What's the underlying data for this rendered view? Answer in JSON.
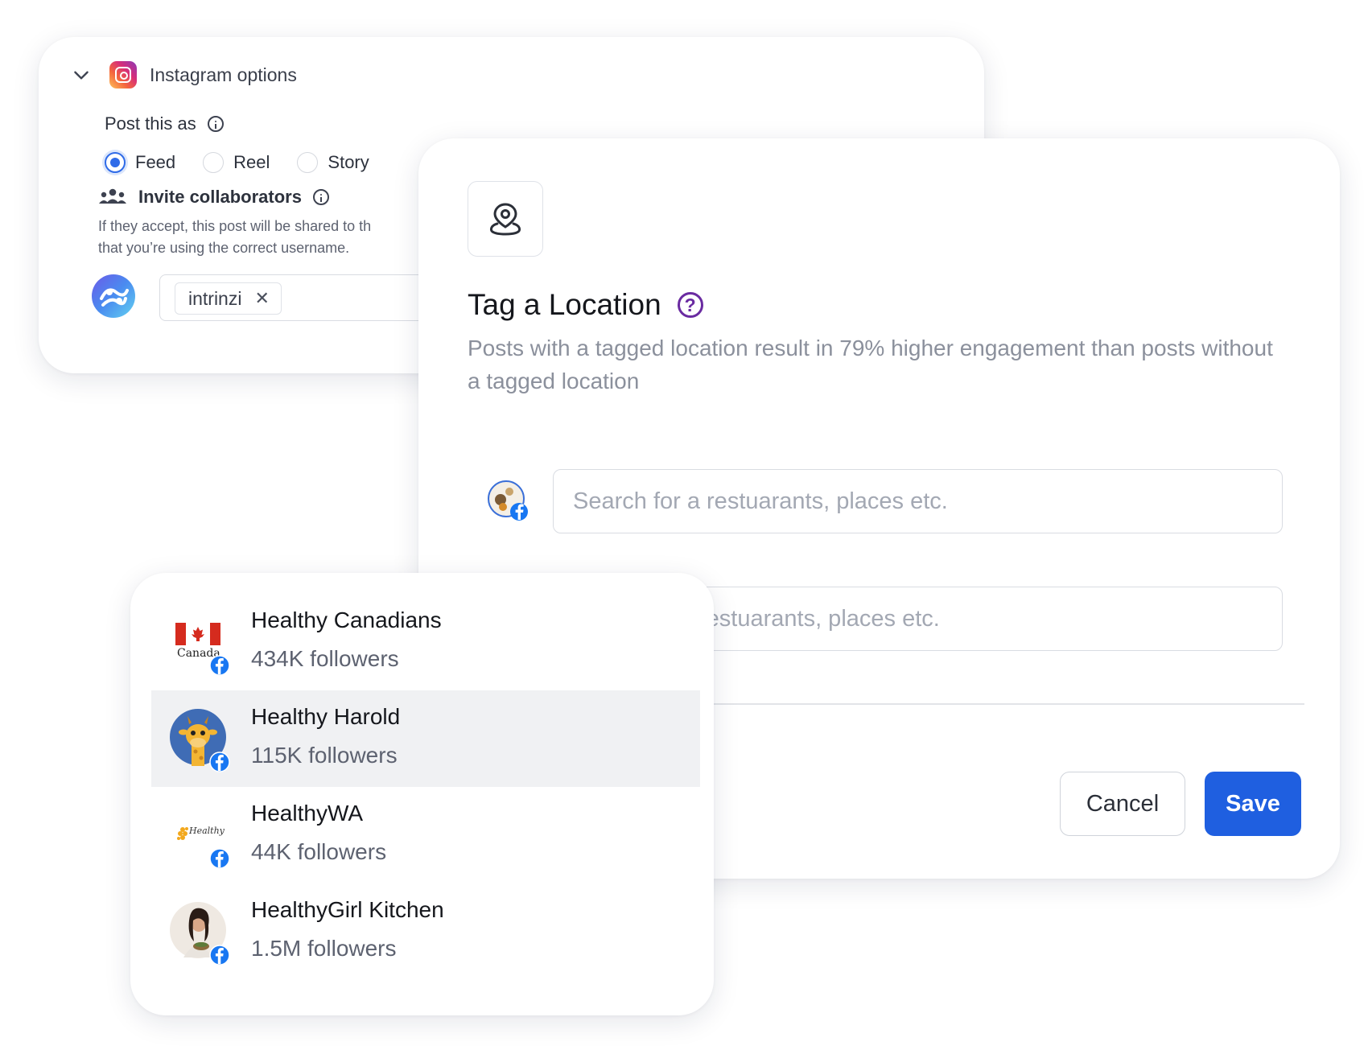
{
  "instagram_options": {
    "title": "Instagram options",
    "post_as_label": "Post this as",
    "post_types": [
      {
        "label": "Feed",
        "selected": true
      },
      {
        "label": "Reel",
        "selected": false
      },
      {
        "label": "Story",
        "selected": false
      }
    ],
    "collaborators_label": "Invite collaborators",
    "collaborators_desc_line1": "If they accept, this post will be shared to th",
    "collaborators_desc_line2": "that you’re using the correct username.",
    "collaborator_chip": "intrinzi",
    "chip_remove_icon": "close-icon"
  },
  "tag_location": {
    "title": "Tag a Location",
    "help_icon": "question-mark-icon",
    "subtitle": "Posts with a tagged location result in 79% higher engagement than posts without a tagged location",
    "search_placeholder": "Search for a restuarants, places etc.",
    "second_field_visible_text": "restuarants, places etc.",
    "cancel_label": "Cancel",
    "save_label": "Save",
    "accent_color": "#1f5fe0"
  },
  "results": [
    {
      "name": "Healthy Canadians",
      "followers": "434K followers",
      "avatar_text": "Canada",
      "highlighted": false
    },
    {
      "name": "Healthy Harold",
      "followers": "115K followers",
      "highlighted": true
    },
    {
      "name": "HealthyWA",
      "followers": "44K followers",
      "avatar_text": "Healthy WA",
      "highlighted": false
    },
    {
      "name": "HealthyGirl Kitchen",
      "followers": "1.5M followers",
      "highlighted": false
    }
  ]
}
